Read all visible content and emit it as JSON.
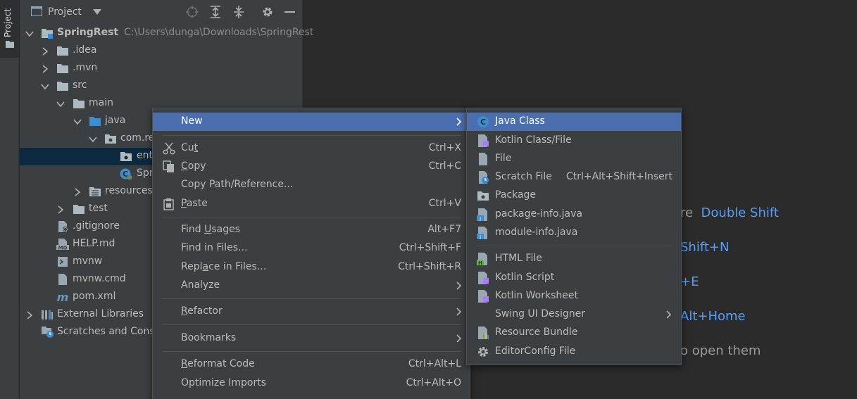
{
  "tool_stripe": {
    "tab_label": "Project"
  },
  "project_panel": {
    "title": "Project",
    "tree": [
      {
        "label": "SpringRest",
        "path": "C:\\Users\\dunga\\Downloads\\SpringRest"
      },
      {
        "label": ".idea"
      },
      {
        "label": ".mvn"
      },
      {
        "label": "src"
      },
      {
        "label": "main"
      },
      {
        "label": "java"
      },
      {
        "label": "com.re"
      },
      {
        "label": "ent"
      },
      {
        "label": "Spr"
      },
      {
        "label": "resources"
      },
      {
        "label": "test"
      },
      {
        "label": ".gitignore"
      },
      {
        "label": "HELP.md"
      },
      {
        "label": "mvnw"
      },
      {
        "label": "mvnw.cmd"
      },
      {
        "label": "pom.xml"
      },
      {
        "label": "External Libraries"
      },
      {
        "label": "Scratches and Conso"
      }
    ]
  },
  "editor_hints": [
    {
      "text": "re",
      "key": "Double Shift"
    },
    {
      "text": "",
      "key": "Shift+N"
    },
    {
      "text": "",
      "key": "+E"
    },
    {
      "text": "",
      "key": "Alt+Home"
    },
    {
      "text": "o open them",
      "key": ""
    }
  ],
  "context_menu": {
    "items": [
      {
        "label": "New",
        "shortcut": ""
      },
      {
        "label_pre": "Cu",
        "label_u": "t",
        "label_post": "",
        "shortcut": "Ctrl+X"
      },
      {
        "label_pre": "",
        "label_u": "C",
        "label_post": "opy",
        "shortcut": "Ctrl+C"
      },
      {
        "label": "Copy Path/Reference...",
        "shortcut": ""
      },
      {
        "label_pre": "",
        "label_u": "P",
        "label_post": "aste",
        "shortcut": "Ctrl+V"
      },
      {
        "label_pre": "Find ",
        "label_u": "U",
        "label_post": "sages",
        "shortcut": "Alt+F7"
      },
      {
        "label": "Find in Files...",
        "shortcut": "Ctrl+Shift+F"
      },
      {
        "label_pre": "Repl",
        "label_u": "a",
        "label_post": "ce in Files...",
        "shortcut": "Ctrl+Shift+R"
      },
      {
        "label": "Analyze",
        "shortcut": ""
      },
      {
        "label_pre": "",
        "label_u": "R",
        "label_post": "efactor",
        "shortcut": ""
      },
      {
        "label": "Bookmarks",
        "shortcut": ""
      },
      {
        "label_pre": "",
        "label_u": "R",
        "label_post": "eformat Code",
        "shortcut": "Ctrl+Alt+L"
      },
      {
        "label": "Optimize Imports",
        "shortcut": "Ctrl+Alt+O"
      }
    ]
  },
  "new_submenu": {
    "items": [
      {
        "label": "Java Class",
        "shortcut": ""
      },
      {
        "label": "Kotlin Class/File",
        "shortcut": ""
      },
      {
        "label": "File",
        "shortcut": ""
      },
      {
        "label": "Scratch File",
        "shortcut": "Ctrl+Alt+Shift+Insert"
      },
      {
        "label": "Package",
        "shortcut": ""
      },
      {
        "label": "package-info.java",
        "shortcut": ""
      },
      {
        "label": "module-info.java",
        "shortcut": ""
      },
      {
        "label": "HTML File",
        "shortcut": ""
      },
      {
        "label": "Kotlin Script",
        "shortcut": ""
      },
      {
        "label": "Kotlin Worksheet",
        "shortcut": ""
      },
      {
        "label": "Swing UI Designer",
        "shortcut": ""
      },
      {
        "label": "Resource Bundle",
        "shortcut": ""
      },
      {
        "label": "EditorConfig File",
        "shortcut": ""
      }
    ]
  },
  "colors": {
    "panel_bg": "#3c3f41",
    "editor_bg": "#2b2b2b",
    "selection": "#4b6eaf",
    "tree_selection": "#0d293e",
    "hint_key": "#589df6",
    "folder_icon": "#aeb9c0",
    "source_folder_icon": "#3f8dd1"
  }
}
